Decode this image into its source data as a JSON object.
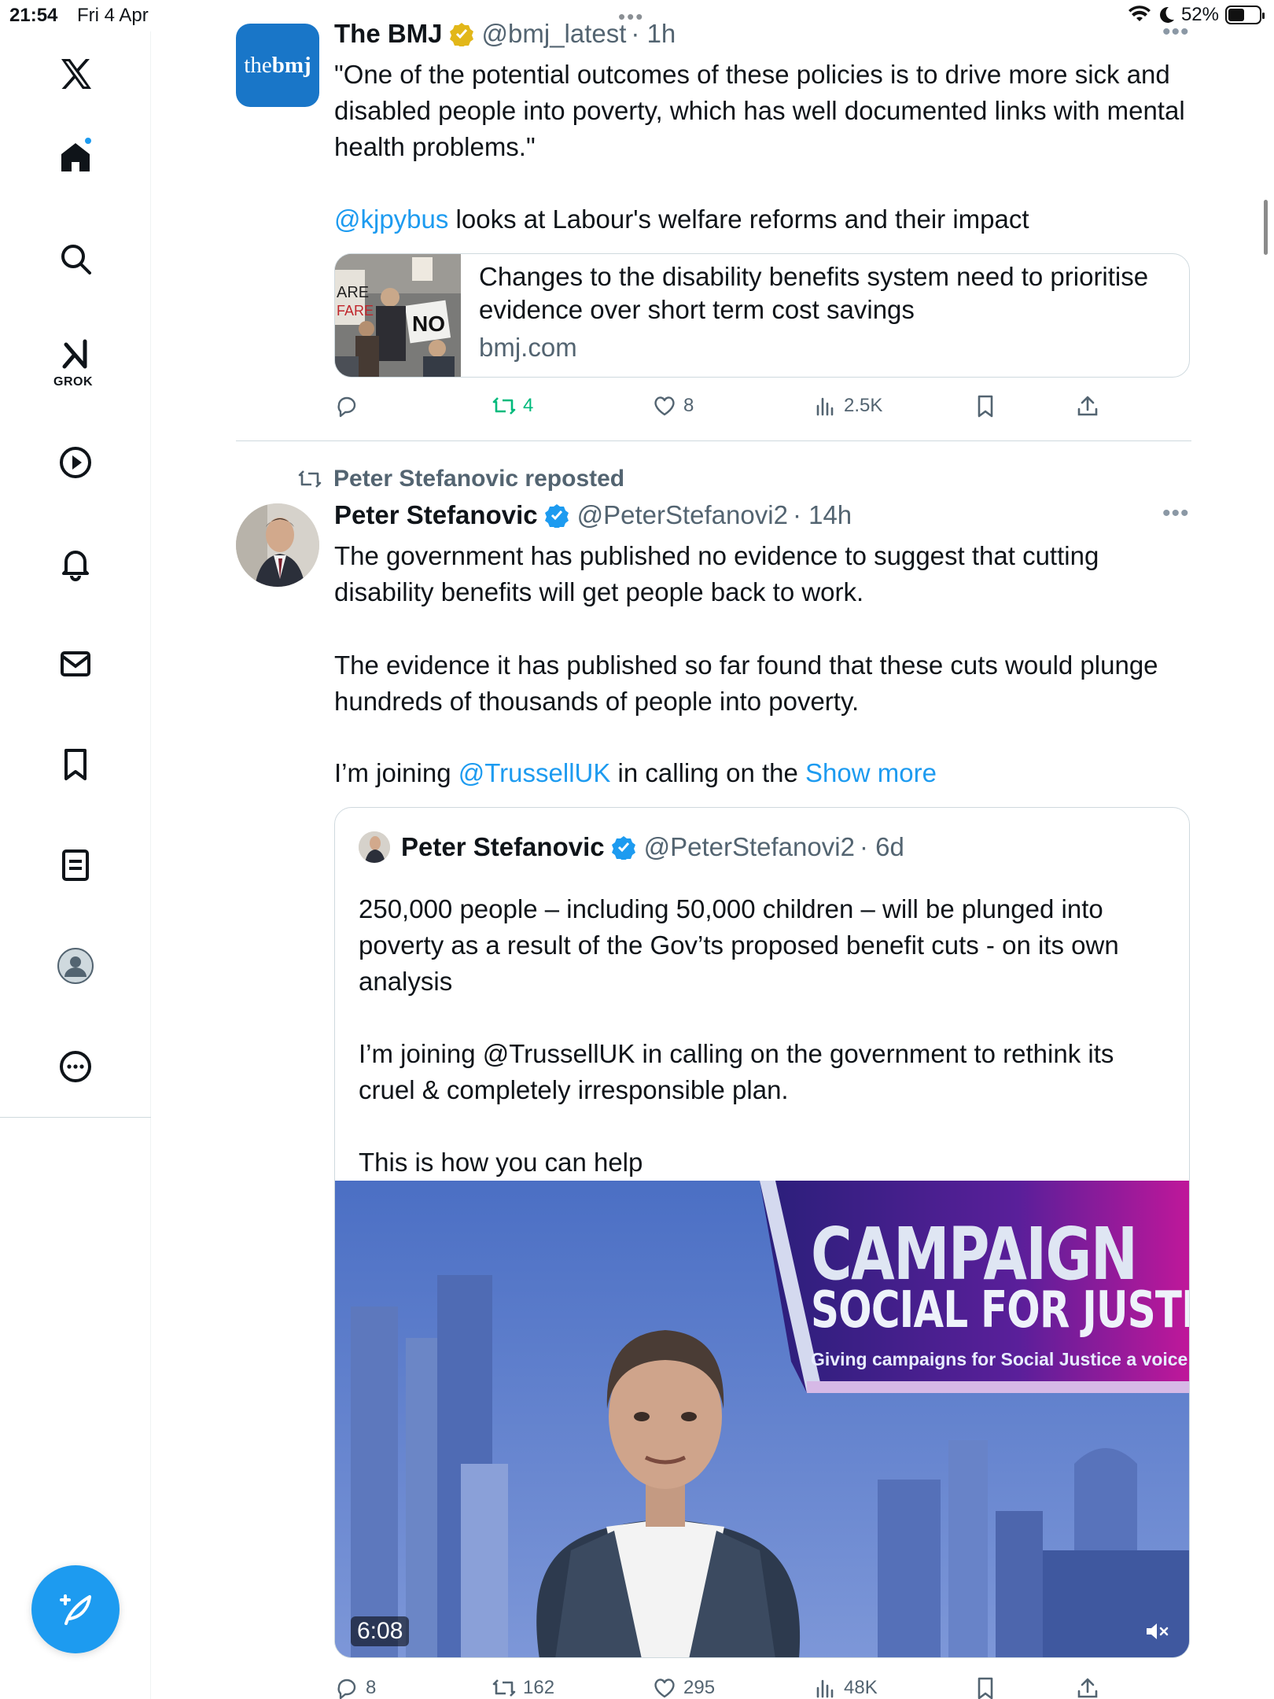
{
  "status_bar": {
    "time": "21:54",
    "date": "Fri 4 Apr",
    "battery": "52%",
    "battery_level": 0.52
  },
  "sidebar": {
    "items": [
      {
        "name": "x-logo-icon"
      },
      {
        "name": "home-icon"
      },
      {
        "name": "search-icon"
      },
      {
        "name": "grok-icon",
        "label": "GROK"
      },
      {
        "name": "video-icon"
      },
      {
        "name": "notifications-icon"
      },
      {
        "name": "messages-icon"
      },
      {
        "name": "bookmarks-icon"
      },
      {
        "name": "lists-icon"
      },
      {
        "name": "profile-icon"
      },
      {
        "name": "more-icon"
      }
    ],
    "compose_icon": "compose-icon"
  },
  "tweets": [
    {
      "author": "The BMJ",
      "handle": "@bmj_latest",
      "time": "· 1h",
      "avatar_text_light": "the",
      "avatar_text_bold": "bmj",
      "text_line1": "\"One of the potential outcomes of these policies is to drive more sick and disabled people into poverty, which has well documented links with mental health problems.\"",
      "mention": "@kjpybus",
      "text_line2": " looks at Labour's welfare reforms and their impact",
      "card": {
        "title": "Changes to the disability benefits system need to prioritise evidence over short term cost savings",
        "domain": "bmj.com"
      },
      "stats": {
        "replies": "",
        "reposts": "4",
        "likes": "8",
        "views": "2.5K"
      }
    },
    {
      "repost_by": "Peter Stefanovic reposted",
      "author": "Peter Stefanovic",
      "handle": "@PeterStefanovi2",
      "time": "· 14h",
      "text_p1": "The government has published no evidence to suggest that cutting disability benefits will get people back to work.",
      "text_p2": "The evidence it has published so far found that these cuts would plunge hundreds of thousands of people into poverty.",
      "text_p3_start": "I’m joining ",
      "text_p3_mention": "@TrussellUK",
      "text_p3_end": " in calling on the ",
      "show_more": "Show more",
      "quote": {
        "author": "Peter Stefanovic",
        "handle": "@PeterStefanovi2",
        "time": "· 6d",
        "p1": "250,000 people – including 50,000 children – will be plunged into poverty as a result of the Gov’ts proposed benefit cuts - on its own analysis",
        "p2": "I’m joining @TrussellUK in calling on the government to rethink its cruel & completely irresponsible plan.",
        "p3": "This is how you can help",
        "video": {
          "duration": "6:08",
          "banner_title": "CAMPAIGN",
          "banner_line2": "SOCIAL FOR JUSTICE",
          "banner_sub": "Giving campaigns for Social Justice a voice"
        }
      },
      "stats": {
        "replies": "8",
        "reposts": "162",
        "likes": "295",
        "views": "48K"
      }
    }
  ],
  "colors": {
    "accent": "#1d9bf0",
    "repost_green": "#00ba7c",
    "muted": "#536471",
    "gold_badge": "#e2b719",
    "bmj_blue": "#1976c8"
  }
}
